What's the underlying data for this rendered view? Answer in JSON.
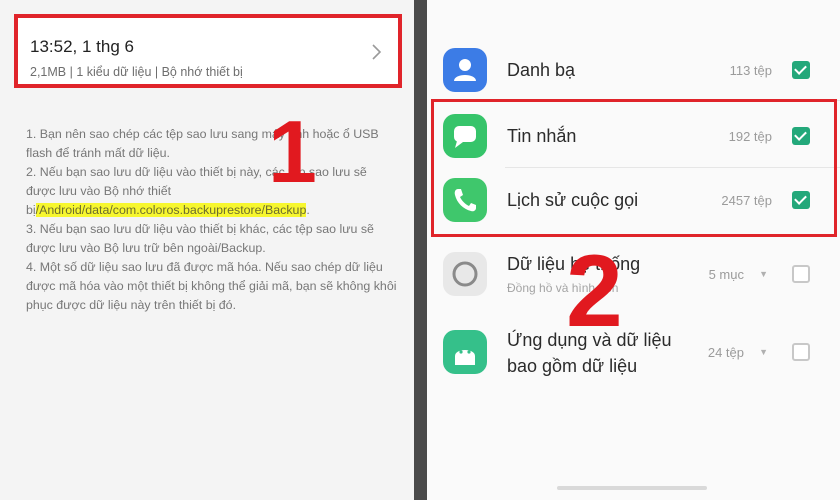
{
  "left": {
    "backup_entry": {
      "time": "13:52, 1 thg 6",
      "meta": "2,1MB  | 1 kiểu dữ liệu  | Bộ nhớ thiết bị"
    },
    "notes": {
      "line1": "1. Bạn nên sao chép các tệp sao lưu sang máy tính hoặc ổ USB flash để tránh mất dữ liệu.",
      "line2_pre": "2. Nếu bạn sao lưu dữ liệu vào thiết bị này, các tệp sao lưu sẽ được lưu vào Bộ nhớ thiết bị",
      "line2_path": "/Android/data/com.coloros.backuprestore/Backup",
      "line2_post": ".",
      "line3": "3. Nếu bạn sao lưu dữ liệu vào thiết bị khác, các tệp sao lưu sẽ được lưu vào Bộ lưu trữ bên ngoài/Backup.",
      "line4": "4. Một số dữ liệu sao lưu đã được mã hóa. Nếu sao chép dữ liệu được mã hóa vào một thiết bị không thể giải mã, bạn sẽ không khôi phục được dữ liệu này trên thiết bị đó."
    },
    "step_number": "1"
  },
  "right": {
    "items": [
      {
        "label": "Danh bạ",
        "count": "113 tệp",
        "checked": true,
        "icon": "contacts-icon",
        "color": "#3c7ce6"
      },
      {
        "label": "Tin nhắn",
        "count": "192 tệp",
        "checked": true,
        "icon": "messages-icon",
        "color": "#36c46a"
      },
      {
        "label": "Lịch sử cuộc gọi",
        "count": "2457 tệp",
        "checked": true,
        "icon": "phone-icon",
        "color": "#3fc76c"
      },
      {
        "label": "Dữ liệu hệ thống",
        "sub": "Đồng hồ và hình nền",
        "count": "5 mục",
        "checked": false,
        "icon": "system-data-icon",
        "color": "#9a9a9a"
      },
      {
        "label": "Ứng dụng và dữ liệu",
        "label2": "bao gồm dữ liệu",
        "count": "24 tệp",
        "checked": false,
        "icon": "android-icon",
        "color": "#35c08a"
      }
    ],
    "step_number": "2"
  },
  "colors": {
    "highlight_box": "#e0242a",
    "step_number": "#e1191f",
    "checkbox_on": "#23a87a"
  }
}
